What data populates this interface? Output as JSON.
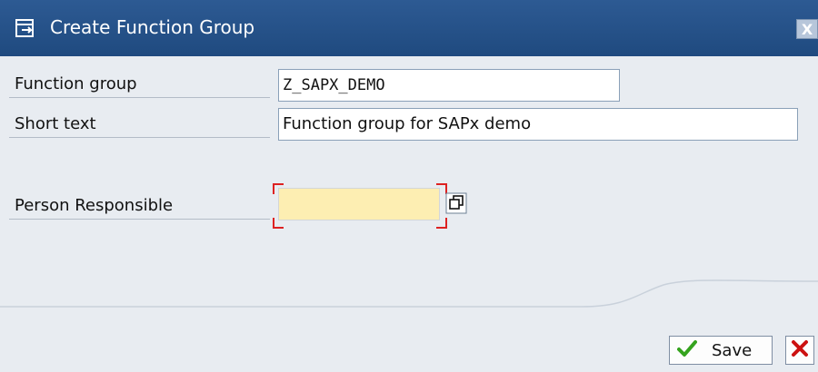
{
  "window": {
    "title": "Create Function Group",
    "close_label": "X"
  },
  "form": {
    "function_group": {
      "label": "Function group",
      "value": "Z_SAPX_DEMO"
    },
    "short_text": {
      "label": "Short text",
      "value": "Function group for SAPx demo"
    },
    "person_responsible": {
      "label": "Person Responsible",
      "value": ""
    }
  },
  "buttons": {
    "save_label": "Save"
  },
  "icons": {
    "title": "create-document-icon",
    "help": "possible-entries-icon",
    "save": "green-check-icon",
    "cancel": "red-x-icon"
  },
  "colors": {
    "titlebar": "#1f4a7f",
    "required_field": "#fdeeb2",
    "save_check": "#35a31e",
    "cancel_x": "#cc1111"
  }
}
